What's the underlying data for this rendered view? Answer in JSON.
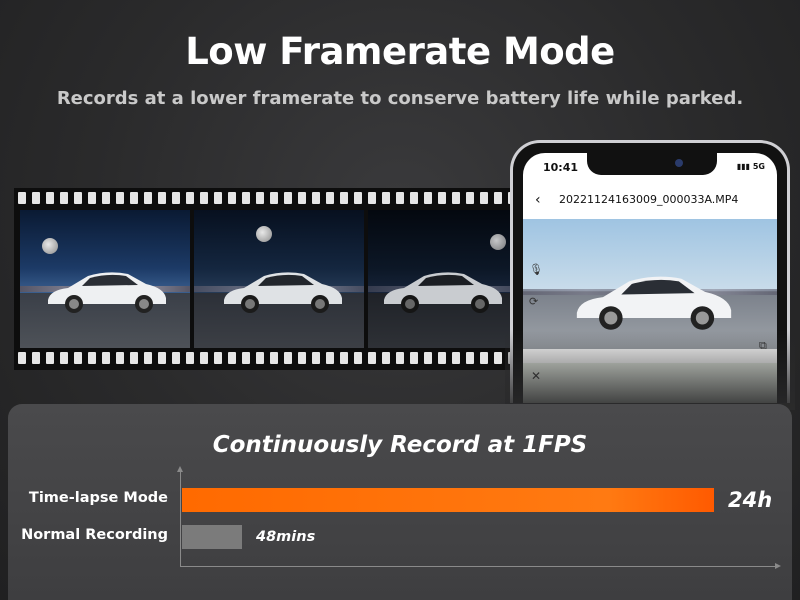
{
  "header": {
    "title": "Low Framerate Mode",
    "subtitle": "Records at a lower framerate to conserve battery life while parked."
  },
  "phone": {
    "time": "10:41",
    "signal": "5G",
    "file_name": "20221124163009_000033A.MP4"
  },
  "panel": {
    "title": "Continuously Record at 1FPS",
    "rows": [
      {
        "label": "Time-lapse Mode",
        "value": "24h",
        "fraction": 1.0,
        "color": "#ff6a00"
      },
      {
        "label": "Normal Recording",
        "value": "48mins",
        "fraction": 0.0333,
        "color": "#7b7b7b"
      }
    ]
  },
  "icons": {
    "back": "chevron-left-icon",
    "mic": "microphone-icon",
    "camera": "camera-switch-icon",
    "pip": "picture-in-picture-icon",
    "close": "close-icon"
  }
}
